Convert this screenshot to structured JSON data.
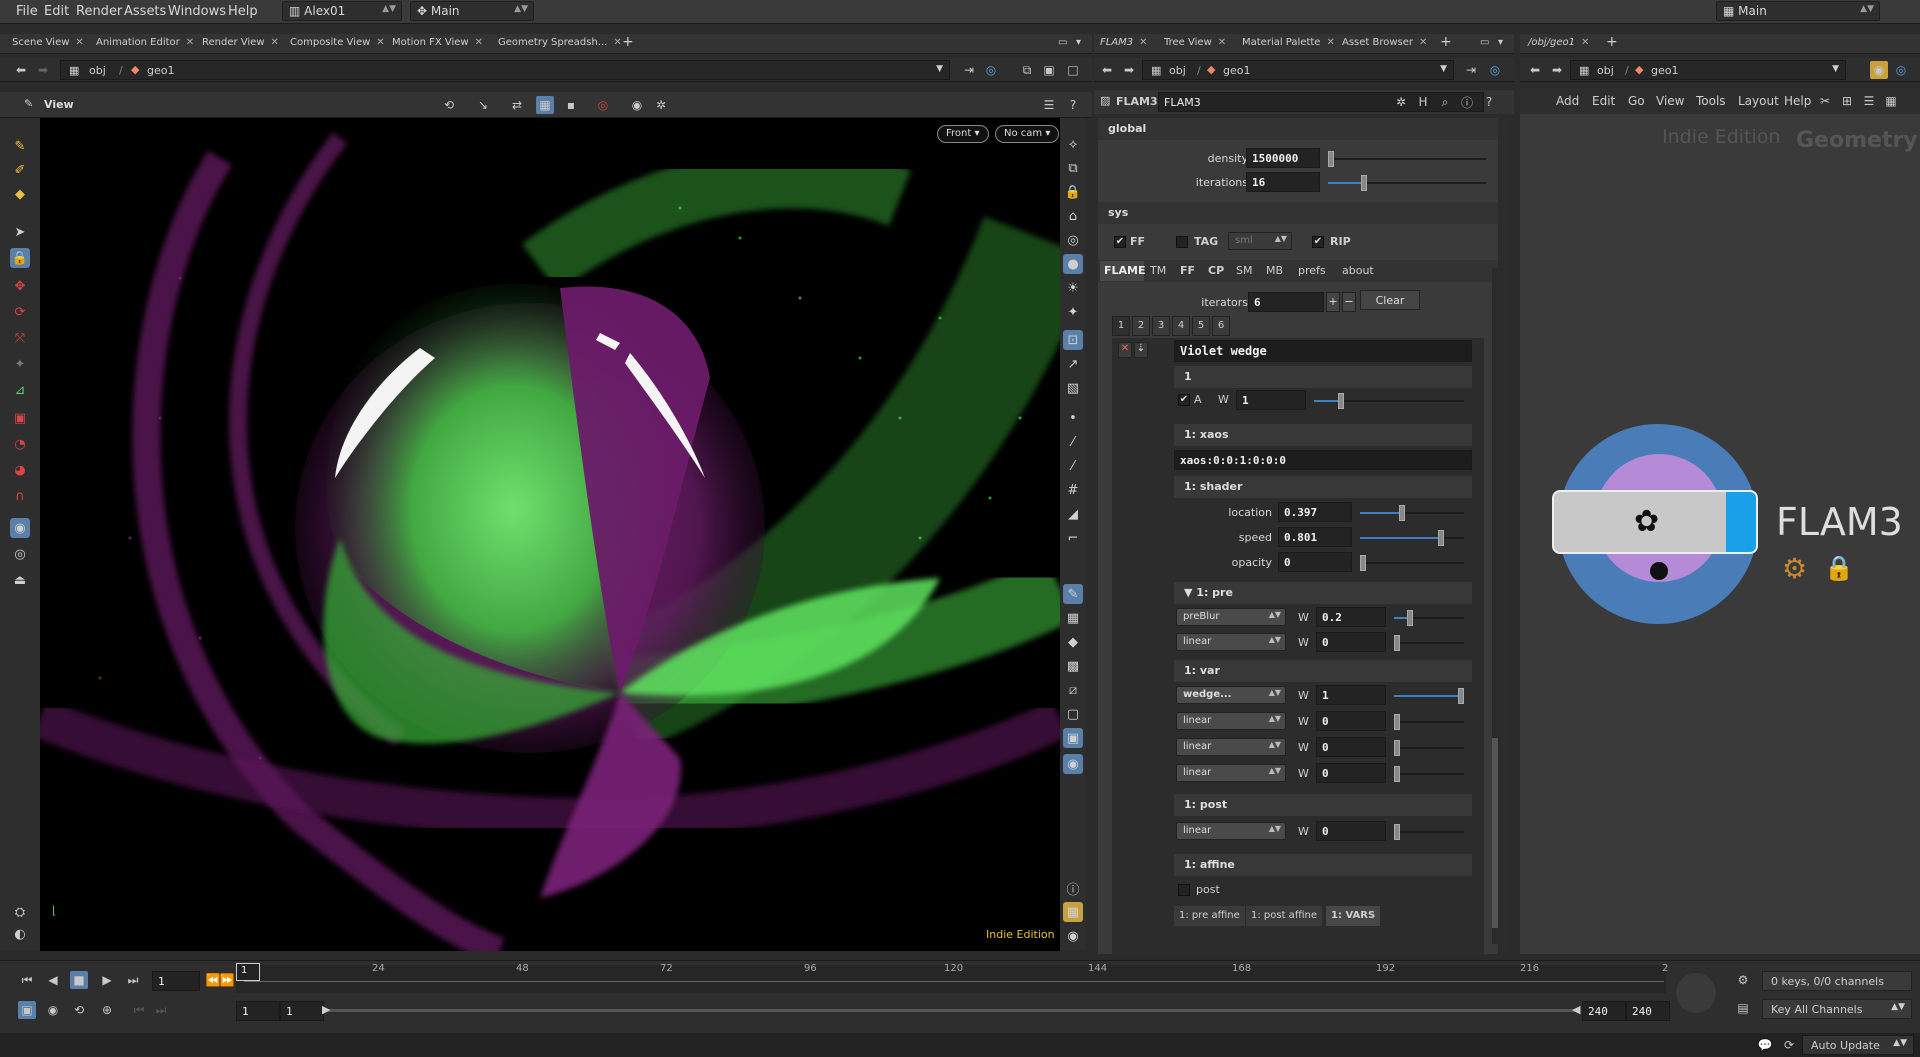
{
  "menubar": {
    "items": [
      "File",
      "Edit",
      "Render",
      "Assets",
      "Windows",
      "Help"
    ],
    "desktop": "Alex01",
    "context": "Main",
    "right_context": "Main"
  },
  "left_pane": {
    "tabs": [
      "Scene View",
      "Animation Editor",
      "Render View",
      "Composite View",
      "Motion FX View",
      "Geometry Spreadsh..."
    ],
    "path": [
      "obj",
      "geo1"
    ],
    "view_label": "View",
    "camera_menu": "Front",
    "cam_menu": "No cam",
    "watermark": "Indie Edition"
  },
  "mid_pane": {
    "tabs": [
      "FLAM3",
      "Tree View",
      "Material Palette",
      "Asset Browser"
    ],
    "path": [
      "obj",
      "geo1"
    ],
    "node_type": "FLAM3",
    "node_name": "FLAM3"
  },
  "params": {
    "global_label": "global",
    "density_label": "density",
    "density": "1500000",
    "density_frac": 0.0,
    "iterations_label": "iterations",
    "iterations": "16",
    "iterations_frac": 0.22,
    "sys_label": "sys",
    "ff_label": "FF",
    "tag_label": "TAG",
    "sml": "sml",
    "rip_label": "RIP",
    "tabs": [
      "FLAME",
      "TM",
      "FF",
      "CP",
      "SM",
      "MB",
      "prefs",
      "about"
    ],
    "iterators_label": "iterators",
    "iterators": "6",
    "plus": "+",
    "minus": "−",
    "clear": "Clear",
    "iter_tabs": [
      "1",
      "2",
      "3",
      "4",
      "5",
      "6"
    ],
    "iter_name": "Violet wedge",
    "iter_num": "1",
    "a_label": "A",
    "w_label": "W",
    "weight": "1",
    "weight_frac": 0.17,
    "xaos_label": "1: xaos",
    "xaos": "xaos:0:0:1:0:0:0",
    "shader_label": "1: shader",
    "location_label": "location",
    "location": "0.397",
    "location_frac": 0.397,
    "speed_label": "speed",
    "speed": "0.801",
    "speed_frac": 0.801,
    "opacity_label": "opacity",
    "opacity": "0",
    "opacity_frac": 0.0,
    "pre_label": "1: pre",
    "pre_rows": [
      {
        "type": "preBlur",
        "w": "0.2",
        "frac": 0.2
      },
      {
        "type": "linear",
        "w": "0",
        "frac": 0.0
      }
    ],
    "var_label": "1: var",
    "var_rows": [
      {
        "type": "wedge...",
        "w": "1",
        "frac": 1.0
      },
      {
        "type": "linear",
        "w": "0",
        "frac": 0.0
      },
      {
        "type": "linear",
        "w": "0",
        "frac": 0.0
      },
      {
        "type": "linear",
        "w": "0",
        "frac": 0.0
      }
    ],
    "post_label": "1: post",
    "post_row": {
      "type": "linear",
      "w": "0",
      "frac": 0.0
    },
    "affine_label": "1: affine",
    "post_check_label": "post",
    "bottom_tabs": [
      "1: pre affine",
      "1: post affine",
      "1: VARS"
    ]
  },
  "network": {
    "tab": "/obj/geo1",
    "path": [
      "obj",
      "geo1"
    ],
    "menu": [
      "Add",
      "Edit",
      "Go",
      "View",
      "Tools",
      "Layout",
      "Help"
    ],
    "watermark": "Indie Edition",
    "context_label": "Geometry",
    "node_label": "FLAM3"
  },
  "timeline": {
    "frame": "1",
    "ticks": [
      "24",
      "48",
      "72",
      "96",
      "120",
      "144",
      "168",
      "192",
      "216",
      "2"
    ],
    "current_marker": "1",
    "start": "1",
    "start2": "1",
    "end": "240",
    "end2": "240",
    "keys_info": "0 keys, 0/0 channels",
    "key_all": "Key All Channels",
    "auto_update": "Auto Update"
  }
}
